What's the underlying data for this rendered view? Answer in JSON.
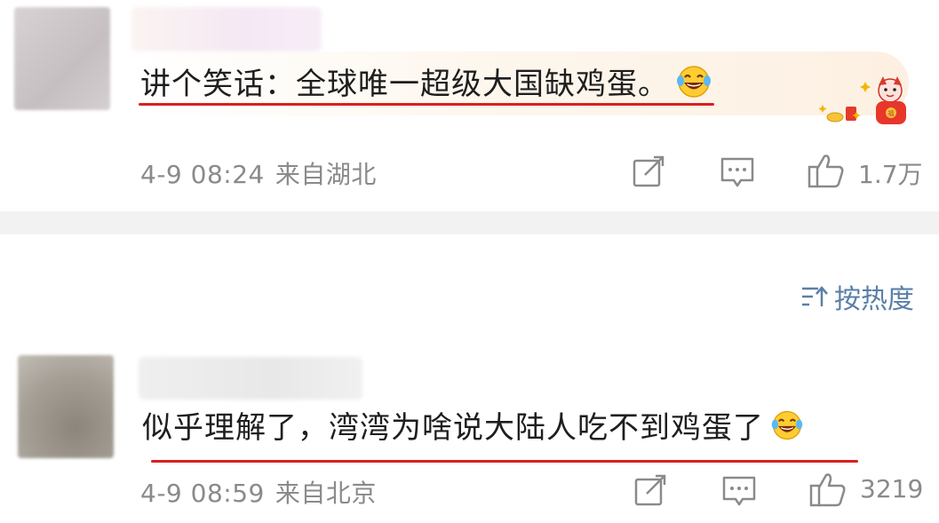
{
  "comments": [
    {
      "text": "讲个笑话：全球唯一超级大国缺鸡蛋。",
      "date": "4-9 08:24",
      "location": "来自湖北",
      "likes": "1.7万",
      "emoji": "laughing-tears-emoji",
      "has_sticker": true
    },
    {
      "text": "似乎理解了，湾湾为啥说大陆人吃不到鸡蛋了",
      "date": "4-9 08:59",
      "location": "来自北京",
      "likes": "3219",
      "emoji": "laughing-tears-emoji"
    }
  ],
  "sort": {
    "label": "按热度",
    "icon": "sort-icon"
  },
  "icons": {
    "share": "share-icon",
    "comment": "comment-icon",
    "like": "thumbs-up-icon"
  },
  "colors": {
    "underline": "#d9201f",
    "meta_text": "#8a8a8a",
    "sort_text": "#5a7fa8",
    "divider": "#f2f2f2"
  }
}
